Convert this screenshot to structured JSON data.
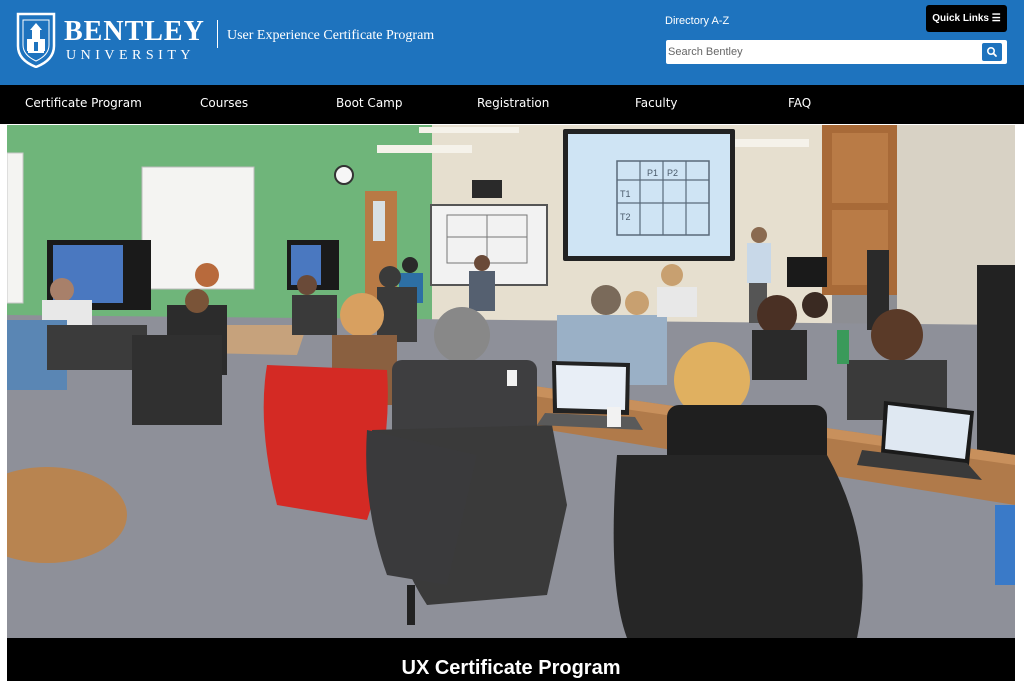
{
  "header": {
    "logo_name": "BENTLEY",
    "logo_sub": "UNIVERSITY",
    "program_title": "User Experience Certificate Program",
    "directory_link": "Directory A-Z",
    "quick_links_label": "Quick Links ☰",
    "search_placeholder": "Search Bentley",
    "search_value": "",
    "bg_color": "#1e73be"
  },
  "nav": {
    "items": [
      {
        "label": "Certificate Program"
      },
      {
        "label": "Courses"
      },
      {
        "label": "Boot Camp"
      },
      {
        "label": "Registration"
      },
      {
        "label": "Faculty"
      },
      {
        "label": "FAQ"
      }
    ]
  },
  "hero": {
    "board_labels": [
      "P1",
      "P2",
      "T1",
      "T2"
    ],
    "caption": "UX Certificate Program"
  }
}
